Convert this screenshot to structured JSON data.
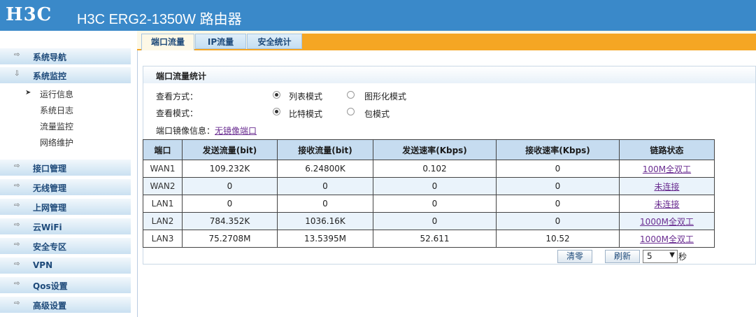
{
  "header": {
    "logo": "H3C",
    "title": "H3C ERG2-1350W 路由器"
  },
  "sidebar": {
    "items": [
      {
        "label": "系统导航"
      },
      {
        "label": "系统监控"
      },
      {
        "label": "接口管理"
      },
      {
        "label": "无线管理"
      },
      {
        "label": "上网管理"
      },
      {
        "label": "云WiFi"
      },
      {
        "label": "安全专区"
      },
      {
        "label": "VPN"
      },
      {
        "label": "Qos设置"
      },
      {
        "label": "高级设置"
      }
    ],
    "subitems": [
      {
        "label": "运行信息"
      },
      {
        "label": "系统日志"
      },
      {
        "label": "流量监控"
      },
      {
        "label": "网络维护"
      }
    ]
  },
  "tabs": [
    {
      "label": "端口流量"
    },
    {
      "label": "IP流量"
    },
    {
      "label": "安全统计"
    }
  ],
  "panel": {
    "title": "端口流量统计",
    "view_method_label": "查看方式：",
    "view_method_options": [
      "列表模式",
      "图形化模式"
    ],
    "view_mode_label": "查看模式：",
    "view_mode_options": [
      "比特模式",
      "包模式"
    ],
    "mirror_label": "端口镜像信息：",
    "mirror_value": "无镜像端口"
  },
  "table": {
    "headers": [
      "端口",
      "发送流量(bit)",
      "接收流量(bit)",
      "发送速率(Kbps)",
      "接收速率(Kbps)",
      "链路状态"
    ],
    "rows": [
      {
        "port": "WAN1",
        "tx": "109.232K",
        "rx": "6.24800K",
        "tx_rate": "0.102",
        "rx_rate": "0",
        "status": "100M全双工"
      },
      {
        "port": "WAN2",
        "tx": "0",
        "rx": "0",
        "tx_rate": "0",
        "rx_rate": "0",
        "status": "未连接"
      },
      {
        "port": "LAN1",
        "tx": "0",
        "rx": "0",
        "tx_rate": "0",
        "rx_rate": "0",
        "status": "未连接"
      },
      {
        "port": "LAN2",
        "tx": "784.352K",
        "rx": "1036.16K",
        "tx_rate": "0",
        "rx_rate": "0",
        "status": "1000M全双工"
      },
      {
        "port": "LAN3",
        "tx": "75.2708M",
        "rx": "13.5395M",
        "tx_rate": "52.611",
        "rx_rate": "10.52",
        "status": "1000M全双工"
      }
    ]
  },
  "controls": {
    "clear": "清零",
    "refresh": "刷新",
    "interval": "5",
    "unit": "秒"
  },
  "colors": {
    "header": "#3a89c9",
    "accent": "#f5a623",
    "link": "#6a2d91"
  }
}
